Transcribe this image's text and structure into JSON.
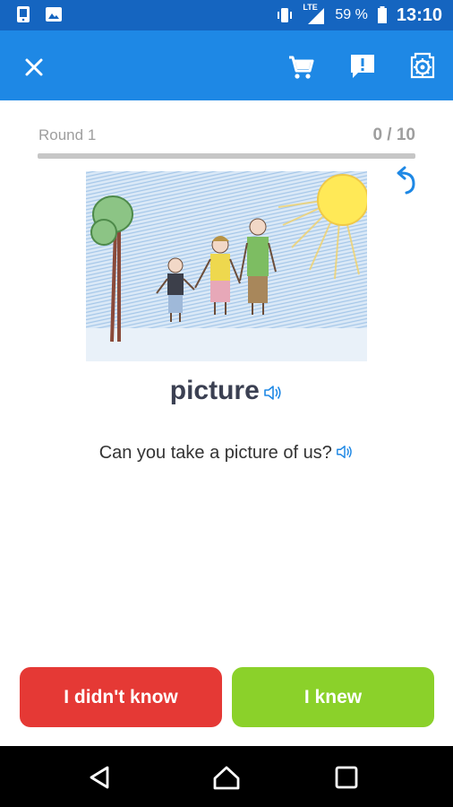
{
  "status_bar": {
    "icons_left": [
      "phone-notification-icon",
      "image-notification-icon"
    ],
    "signal_label": "LTE",
    "battery": "59 %",
    "time": "13:10"
  },
  "app_bar": {
    "close_icon": "close-icon",
    "actions": [
      "cart-icon",
      "report-icon",
      "settings-icon"
    ],
    "color": "#1e88e5"
  },
  "progress": {
    "round_label": "Round 1",
    "count": "0 / 10",
    "fraction": 0
  },
  "card": {
    "image_icon": "family-drawing-illustration",
    "word": "picture",
    "sentence": "Can you take a picture of us?",
    "audio_icon": "speaker-icon"
  },
  "buttons": {
    "didnt_know": "I didn't know",
    "knew": "I knew",
    "didnt_know_color": "#e53935",
    "knew_color": "#8bd12a"
  },
  "nav": [
    "back-icon",
    "home-icon",
    "recent-apps-icon"
  ]
}
